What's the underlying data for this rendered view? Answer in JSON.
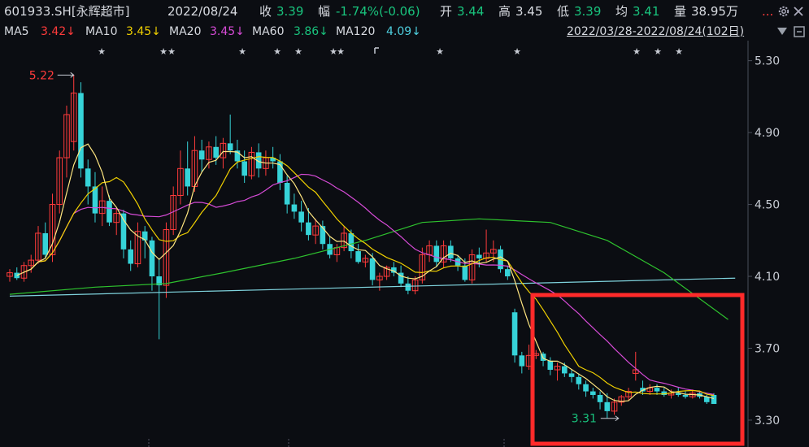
{
  "header": {
    "code": "601933.SH[永辉超市]",
    "date": "2022/08/24",
    "close_label": "收",
    "close": "3.39",
    "change_label": "幅",
    "change": "-1.74%(-0.06)",
    "open_label": "开",
    "open": "3.44",
    "high_label": "高",
    "high": "3.45",
    "low_label": "低",
    "low": "3.39",
    "avg_label": "均",
    "avg": "3.41",
    "vol_label": "量",
    "vol": "38.95万",
    "dots": "..."
  },
  "ma_bar": {
    "ma5_label": "MA5",
    "ma5": "3.42↓",
    "ma10_label": "MA10",
    "ma10": "3.45↓",
    "ma20_label": "MA20",
    "ma20": "3.45↓",
    "ma60_label": "MA60",
    "ma60": "3.86↓",
    "ma120_label": "MA120",
    "ma120": "4.09↓",
    "range": "2022/03/28-2022/08/24(102日)",
    "dropdown_icon": "caret-down-icon"
  },
  "colors": {
    "up": "#ff3b3b",
    "down": "#36d3d8",
    "ma5": "#f0d000",
    "ma10": "#f0d000",
    "ma20": "#d64bd6",
    "ma60": "#2ec22e",
    "ma120": "#7fd3dd",
    "highlight_box": "#ff2a2a"
  },
  "chart_data": {
    "type": "candlestick",
    "ylim": [
      3.25,
      5.33
    ],
    "yticks": [
      "5.30",
      "4.90",
      "4.50",
      "4.10",
      "3.70",
      "3.30"
    ],
    "annotations": {
      "high": "5.22",
      "low": "3.31"
    },
    "candles_ohlc": [
      [
        4.1,
        4.14,
        4.07,
        4.12
      ],
      [
        4.12,
        4.15,
        4.08,
        4.09
      ],
      [
        4.09,
        4.18,
        4.07,
        4.16
      ],
      [
        4.16,
        4.22,
        4.12,
        4.19
      ],
      [
        4.19,
        4.38,
        4.17,
        4.34
      ],
      [
        4.34,
        4.4,
        4.2,
        4.22
      ],
      [
        4.22,
        4.56,
        4.18,
        4.5
      ],
      [
        4.5,
        4.8,
        4.45,
        4.76
      ],
      [
        4.76,
        5.05,
        4.65,
        5.0
      ],
      [
        4.85,
        5.22,
        4.8,
        5.12
      ],
      [
        5.12,
        5.18,
        4.65,
        4.7
      ],
      [
        4.7,
        4.75,
        4.5,
        4.6
      ],
      [
        4.6,
        4.68,
        4.4,
        4.45
      ],
      [
        4.45,
        4.6,
        4.38,
        4.52
      ],
      [
        4.52,
        4.55,
        4.38,
        4.4
      ],
      [
        4.4,
        4.48,
        4.33,
        4.45
      ],
      [
        4.45,
        4.47,
        4.2,
        4.25
      ],
      [
        4.25,
        4.3,
        4.13,
        4.17
      ],
      [
        4.17,
        4.4,
        4.15,
        4.35
      ],
      [
        4.35,
        4.38,
        4.2,
        4.3
      ],
      [
        4.3,
        4.32,
        4.02,
        4.1
      ],
      [
        4.1,
        4.2,
        3.75,
        4.05
      ],
      [
        4.05,
        4.4,
        3.98,
        4.36
      ],
      [
        4.36,
        4.6,
        4.33,
        4.55
      ],
      [
        4.55,
        4.8,
        4.5,
        4.7
      ],
      [
        4.7,
        4.85,
        4.55,
        4.6
      ],
      [
        4.6,
        4.88,
        4.57,
        4.8
      ],
      [
        4.8,
        4.86,
        4.68,
        4.75
      ],
      [
        4.75,
        4.85,
        4.7,
        4.82
      ],
      [
        4.82,
        4.88,
        4.72,
        4.76
      ],
      [
        4.76,
        4.87,
        4.7,
        4.84
      ],
      [
        4.84,
        5.0,
        4.78,
        4.8
      ],
      [
        4.8,
        4.86,
        4.7,
        4.74
      ],
      [
        4.74,
        4.8,
        4.62,
        4.66
      ],
      [
        4.66,
        4.82,
        4.64,
        4.79
      ],
      [
        4.79,
        4.84,
        4.65,
        4.7
      ],
      [
        4.7,
        4.8,
        4.66,
        4.76
      ],
      [
        4.76,
        4.82,
        4.7,
        4.74
      ],
      [
        4.74,
        4.78,
        4.58,
        4.62
      ],
      [
        4.62,
        4.66,
        4.45,
        4.5
      ],
      [
        4.5,
        4.56,
        4.42,
        4.46
      ],
      [
        4.46,
        4.52,
        4.35,
        4.4
      ],
      [
        4.4,
        4.48,
        4.3,
        4.33
      ],
      [
        4.33,
        4.42,
        4.28,
        4.38
      ],
      [
        4.38,
        4.41,
        4.25,
        4.28
      ],
      [
        4.28,
        4.32,
        4.2,
        4.22
      ],
      [
        4.22,
        4.28,
        4.18,
        4.26
      ],
      [
        4.26,
        4.38,
        4.24,
        4.34
      ],
      [
        4.34,
        4.36,
        4.2,
        4.24
      ],
      [
        4.24,
        4.28,
        4.17,
        4.18
      ],
      [
        4.18,
        4.22,
        4.15,
        4.2
      ],
      [
        4.2,
        4.23,
        4.05,
        4.08
      ],
      [
        4.08,
        4.12,
        4.02,
        4.1
      ],
      [
        4.1,
        4.16,
        4.08,
        4.15
      ],
      [
        4.15,
        4.18,
        4.1,
        4.12
      ],
      [
        4.12,
        4.16,
        4.04,
        4.06
      ],
      [
        4.06,
        4.1,
        4.0,
        4.02
      ],
      [
        4.02,
        4.1,
        4.0,
        4.08
      ],
      [
        4.08,
        4.26,
        4.06,
        4.22
      ],
      [
        4.22,
        4.3,
        4.18,
        4.27
      ],
      [
        4.27,
        4.3,
        4.15,
        4.18
      ],
      [
        4.18,
        4.3,
        4.15,
        4.27
      ],
      [
        4.27,
        4.3,
        4.18,
        4.2
      ],
      [
        4.2,
        4.22,
        4.13,
        4.16
      ],
      [
        4.16,
        4.2,
        4.07,
        4.08
      ],
      [
        4.08,
        4.25,
        4.06,
        4.22
      ],
      [
        4.22,
        4.26,
        4.15,
        4.2
      ],
      [
        4.2,
        4.36,
        4.18,
        4.23
      ],
      [
        4.23,
        4.3,
        4.18,
        4.25
      ],
      [
        4.25,
        4.27,
        4.12,
        4.14
      ],
      [
        4.14,
        4.16,
        4.08,
        4.1
      ],
      [
        3.9,
        3.92,
        3.62,
        3.66
      ],
      [
        3.66,
        3.68,
        3.56,
        3.6
      ],
      [
        3.6,
        3.72,
        3.58,
        3.66
      ],
      [
        3.66,
        3.69,
        3.64,
        3.67
      ],
      [
        3.67,
        3.68,
        3.6,
        3.63
      ],
      [
        3.63,
        3.65,
        3.55,
        3.58
      ],
      [
        3.58,
        3.62,
        3.52,
        3.6
      ],
      [
        3.6,
        3.62,
        3.54,
        3.56
      ],
      [
        3.56,
        3.58,
        3.51,
        3.54
      ],
      [
        3.54,
        3.56,
        3.47,
        3.5
      ],
      [
        3.5,
        3.52,
        3.43,
        3.46
      ],
      [
        3.46,
        3.48,
        3.42,
        3.44
      ],
      [
        3.44,
        3.46,
        3.36,
        3.4
      ],
      [
        3.4,
        3.45,
        3.31,
        3.35
      ],
      [
        3.35,
        3.42,
        3.33,
        3.4
      ],
      [
        3.4,
        3.44,
        3.38,
        3.43
      ],
      [
        3.43,
        3.48,
        3.41,
        3.46
      ],
      [
        3.56,
        3.68,
        3.52,
        3.58
      ],
      [
        3.48,
        3.52,
        3.44,
        3.46
      ],
      [
        3.46,
        3.5,
        3.44,
        3.48
      ],
      [
        3.48,
        3.5,
        3.44,
        3.46
      ],
      [
        3.46,
        3.48,
        3.43,
        3.44
      ],
      [
        3.44,
        3.47,
        3.42,
        3.45
      ],
      [
        3.45,
        3.48,
        3.43,
        3.44
      ],
      [
        3.44,
        3.46,
        3.42,
        3.43
      ],
      [
        3.43,
        3.47,
        3.42,
        3.45
      ],
      [
        3.45,
        3.46,
        3.42,
        3.43
      ],
      [
        3.43,
        3.44,
        3.39,
        3.4
      ],
      [
        3.44,
        3.45,
        3.39,
        3.39
      ]
    ],
    "ma120": {
      "x": [
        0,
        102
      ],
      "y": [
        3.99,
        4.09
      ]
    },
    "ma60_tail": [
      [
        0,
        4.0
      ],
      [
        12,
        4.04
      ],
      [
        22,
        4.06
      ],
      [
        30,
        4.12
      ],
      [
        40,
        4.2
      ],
      [
        50,
        4.3
      ],
      [
        58,
        4.4
      ],
      [
        66,
        4.42
      ],
      [
        76,
        4.4
      ],
      [
        84,
        4.3
      ],
      [
        92,
        4.12
      ],
      [
        101,
        3.86
      ]
    ]
  },
  "markers": {
    "stars_x": [
      125,
      201,
      211,
      298,
      341,
      367,
      410,
      419,
      541,
      636,
      783,
      809,
      835
    ],
    "flag_x": 461
  }
}
